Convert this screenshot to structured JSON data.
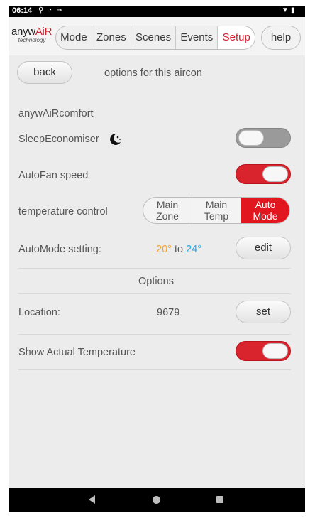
{
  "status_bar": {
    "time": "06:14"
  },
  "app": {
    "brand_prefix": "anyw",
    "brand_accent": "AiR",
    "tagline": "technology"
  },
  "tabs": [
    {
      "label": "Mode",
      "active": false
    },
    {
      "label": "Zones",
      "active": false
    },
    {
      "label": "Scenes",
      "active": false
    },
    {
      "label": "Events",
      "active": false
    },
    {
      "label": "Setup",
      "active": true
    }
  ],
  "help_label": "help",
  "back_label": "back",
  "page_title": "options for this aircon",
  "section_title": "anywAiRcomfort",
  "sleep_economiser": {
    "label": "SleepEconomiser",
    "icon": "moon-stars-icon",
    "enabled": false
  },
  "autofan": {
    "label": "AutoFan speed",
    "enabled": true
  },
  "temperature_control": {
    "label": "temperature control",
    "options": [
      {
        "line1": "Main",
        "line2": "Zone",
        "active": false
      },
      {
        "line1": "Main",
        "line2": "Temp",
        "active": false
      },
      {
        "line1": "Auto",
        "line2": "Mode",
        "active": true
      }
    ]
  },
  "automode": {
    "label": "AutoMode setting:",
    "low": "20°",
    "to": "to",
    "high": "24°",
    "edit_label": "edit"
  },
  "options_header": "Options",
  "location": {
    "label": "Location:",
    "value": "9679",
    "set_label": "set"
  },
  "show_actual_temp": {
    "label": "Show Actual Temperature",
    "enabled": true
  },
  "colors": {
    "accent": "#d9232d",
    "temp_low": "#f2a02d",
    "temp_high": "#2ba9e0"
  }
}
